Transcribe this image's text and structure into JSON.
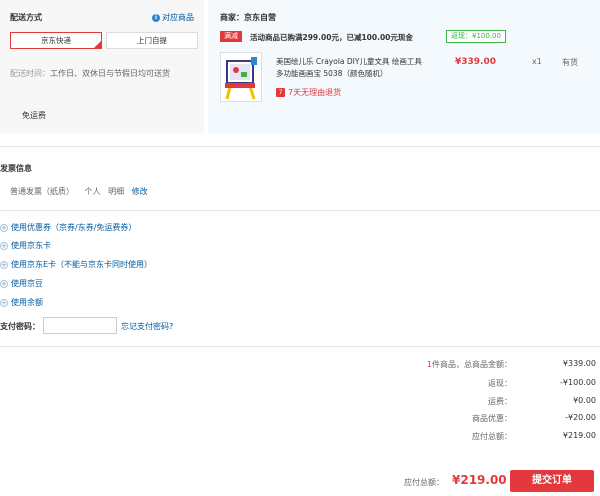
{
  "shipping": {
    "title": "配送方式",
    "match_link": "对应商品",
    "options": [
      "京东快递",
      "上门自提"
    ],
    "time_label": "配送时间：",
    "time_value": "工作日、双休日与节假日均可送货",
    "free_shipping": "免运费"
  },
  "order": {
    "merchant": "商家：京东自营",
    "promo_tag": "满减",
    "promo_text": "活动商品已购满299.00元，已减100.00元现金",
    "rebate": "返现：¥100.00",
    "product_name": "美国绘儿乐 Crayola DIY儿童文具 绘画工具 多功能画画宝 5038（颜色随机）",
    "price": "¥339.00",
    "qty": "x1",
    "stock": "有货",
    "return_text": "7天无理由退货"
  },
  "invoice": {
    "title": "发票信息",
    "type": "普通发票（纸质）",
    "person": "个人",
    "detail": "明细",
    "edit": "修改"
  },
  "options": [
    "使用优惠券（京券/东券/免运费券）",
    "使用京东卡",
    "使用京东E卡（不能与京东卡同时使用）",
    "使用京豆",
    "使用余额"
  ],
  "payment_password": {
    "label": "支付密码：",
    "forgot": "忘记支付密码?"
  },
  "summary": {
    "count_num": "1",
    "count_label": "件商品，总商品金额：",
    "total_goods": "¥339.00",
    "rebate_label": "返现：",
    "rebate_value": "-¥100.00",
    "shipping_label": "运费：",
    "shipping_value": "¥0.00",
    "discount_label": "商品优惠：",
    "discount_value": "-¥20.00",
    "payable_label": "应付总额：",
    "payable_value": "¥219.00"
  },
  "footer": {
    "payable_label": "应付总额：",
    "payable_value": "¥219.00",
    "submit": "提交订单"
  }
}
